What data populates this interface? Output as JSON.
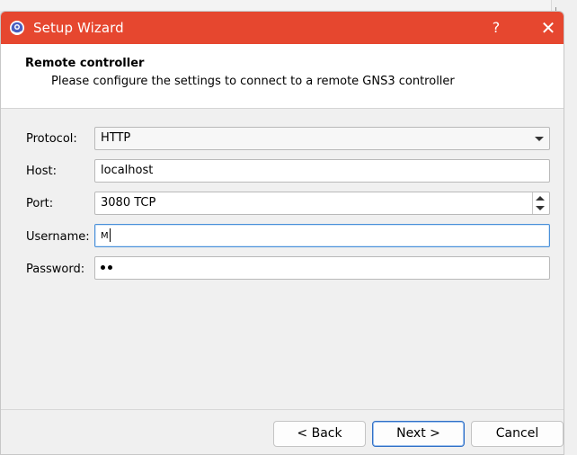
{
  "window": {
    "title": "Setup Wizard",
    "help_glyph": "?",
    "close_glyph": "✕",
    "accent_color": "#e6472f"
  },
  "header": {
    "title": "Remote controller",
    "subtitle": "Please configure the settings to connect to a remote GNS3 controller"
  },
  "form": {
    "protocol": {
      "label": "Protocol:",
      "value": "HTTP"
    },
    "host": {
      "label": "Host:",
      "value": "localhost"
    },
    "port": {
      "label": "Port:",
      "value": "3080 TCP"
    },
    "username": {
      "label": "Username:",
      "value": "M"
    },
    "password": {
      "label": "Password:",
      "masked_length": 2
    }
  },
  "buttons": {
    "back": "< Back",
    "next": "Next >",
    "cancel": "Cancel"
  },
  "icons": {
    "app": "gns3-icon",
    "help": "help-icon",
    "close": "close-icon"
  }
}
